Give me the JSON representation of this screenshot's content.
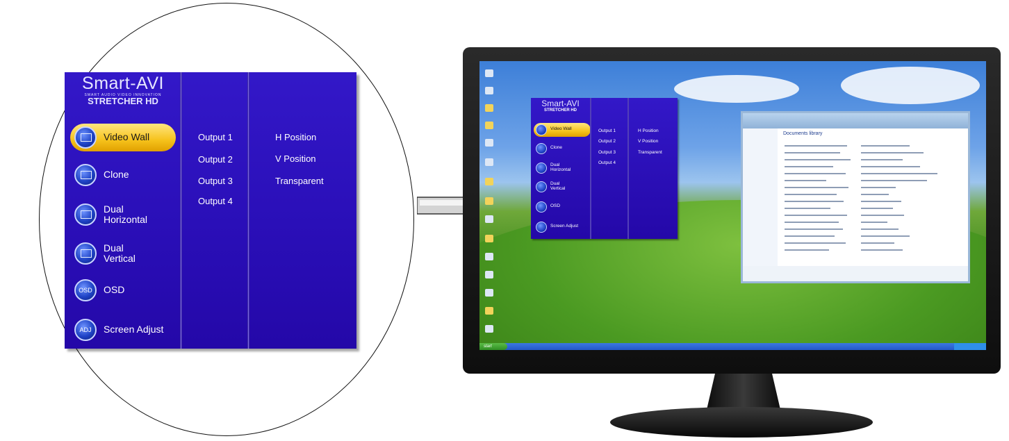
{
  "osd": {
    "brand": "Smart-AVI",
    "tagline": "SMART AUDIO VIDEO INNOVATION",
    "product": "STRETCHER HD",
    "menu": [
      {
        "label": "Video Wall",
        "icon": "video-wall-icon",
        "selected": true
      },
      {
        "label": "Clone",
        "icon": "clone-icon"
      },
      {
        "label": "Dual Horizontal",
        "icon": "dual-horizontal-icon"
      },
      {
        "label": "Dual Vertical",
        "icon": "dual-vertical-icon"
      },
      {
        "label": "OSD",
        "icon": "osd-icon",
        "icon_text": "OSD"
      },
      {
        "label": "Screen Adjust",
        "icon": "screen-adjust-icon",
        "icon_text": "ADJ"
      }
    ],
    "outputs": [
      "Output 1",
      "Output 2",
      "Output 3",
      "Output 4"
    ],
    "settings": [
      "H Position",
      "V Position",
      "Transparent"
    ]
  },
  "desktop": {
    "taskbar_start": "start",
    "explorer_title": "Documents library"
  },
  "colors": {
    "osd_bg": "#2a0fb8",
    "selected_pill": "#f6c21b",
    "monitor_bezel": "#111111"
  }
}
